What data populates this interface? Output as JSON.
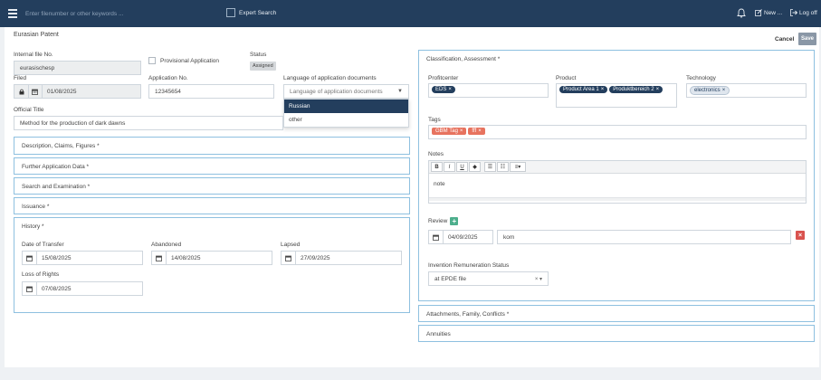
{
  "topbar": {
    "search_placeholder": "Enter filenumber or other keywords ...",
    "expert_search": "Expert Search",
    "new_label": "New ...",
    "logoff_label": "Log off"
  },
  "page": {
    "title": "Eurasian Patent",
    "cancel": "Cancel",
    "save": "Save"
  },
  "form": {
    "internal_file_no_label": "Internal file No.",
    "internal_file_no_value": "eurasischesp",
    "provisional_label": "Provisional Application",
    "status_label": "Status",
    "status_value": "Assigned",
    "filed_label": "Filed",
    "filed_value": "01/08/2025",
    "app_no_label": "Application No.",
    "app_no_value": "12345654",
    "lang_label": "Language of application documents",
    "lang_placeholder": "Language of application documents",
    "lang_options": [
      "Russian",
      "other"
    ],
    "official_title_label": "Official Title",
    "official_title_value": "Method for the production of dark dawns"
  },
  "sections": {
    "description": "Description, Claims, Figures *",
    "further": "Further Application Data *",
    "search": "Search and Examination *",
    "issuance": "Issuance *",
    "history": "History *"
  },
  "history": {
    "date_transfer_label": "Date of Transfer",
    "date_transfer_value": "15/08/2025",
    "abandoned_label": "Abandoned",
    "abandoned_value": "14/08/2025",
    "lapsed_label": "Lapsed",
    "lapsed_value": "27/09/2025",
    "loss_rights_label": "Loss of Rights",
    "loss_rights_value": "07/08/2025"
  },
  "classification": {
    "header": "Classification, Assessment *",
    "profitcenter_label": "Profitcenter",
    "profitcenter_tags": [
      "EDS"
    ],
    "product_label": "Product",
    "product_tags": [
      "Product Area 1",
      "Produktbereich 2"
    ],
    "technology_label": "Technology",
    "technology_tags": [
      "electronics"
    ],
    "tags_label": "Tags",
    "tags": [
      "GBM Tag",
      "fff"
    ],
    "notes_label": "Notes",
    "notes_value": "note",
    "review_label": "Review",
    "review_date": "04/09/2025",
    "review_text": "kom",
    "remuneration_label": "Invention Remuneration Status",
    "remuneration_value": "at EPDE file"
  },
  "right_sections": {
    "attachments": "Attachments, Family, Conflicts *",
    "annuities": "Annuities"
  },
  "colors": {
    "topbar": "#233e5d",
    "section_border": "#8ec0e0",
    "tag_blue": "#233e5d",
    "tag_red": "#e7735f",
    "add_green": "#4cae8c",
    "delete_red": "#d9534f"
  }
}
